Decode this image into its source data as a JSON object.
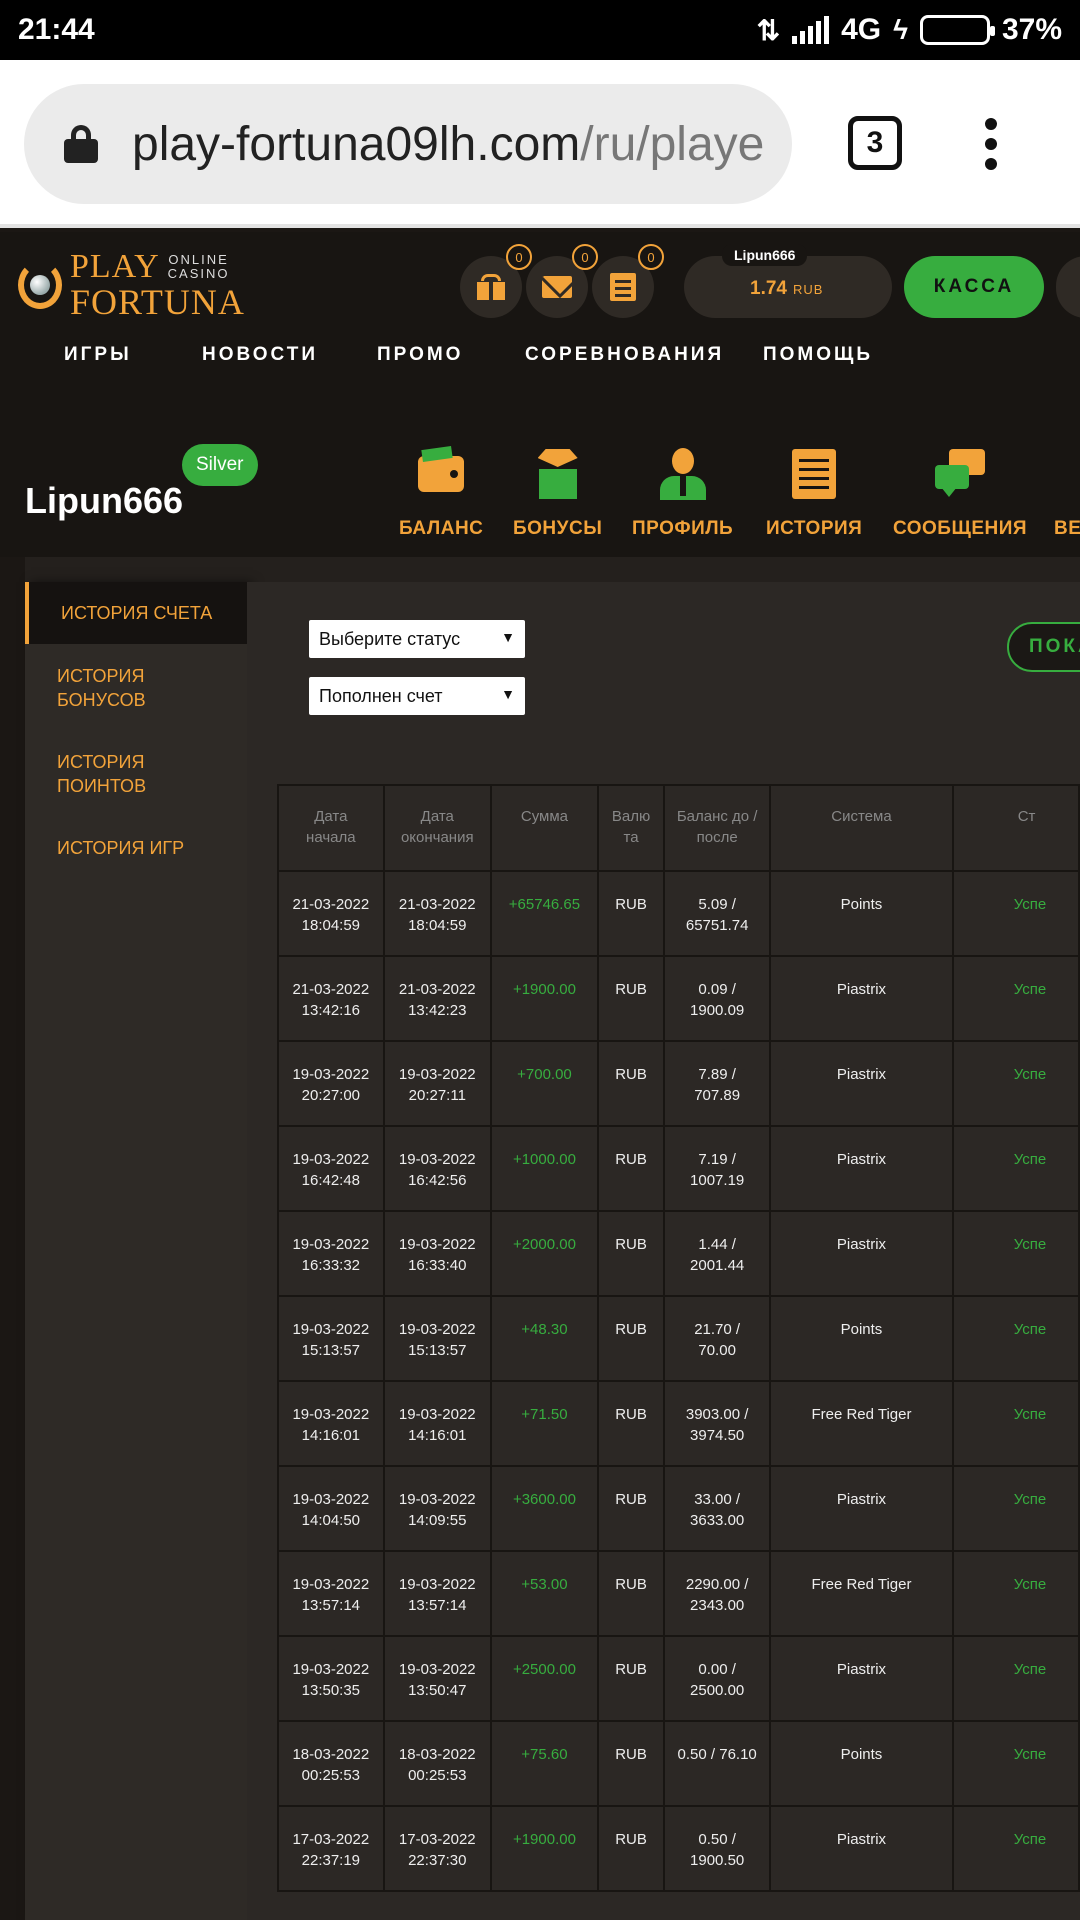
{
  "statusbar": {
    "time": "21:44",
    "network": "4G",
    "battery": "37%"
  },
  "browser": {
    "url_host": "play-fortuna09lh.com",
    "url_path": "/ru/playe",
    "tab_count": "3"
  },
  "header": {
    "logo": {
      "play": "PLAY",
      "online": "ONLINE",
      "casino": "CASINO",
      "fortuna": "FORTUNA"
    },
    "badges": {
      "gifts": "0",
      "messages": "0",
      "notes": "0"
    },
    "balance": {
      "username": "Lipun666",
      "amount": "1.74",
      "currency": "RUB"
    },
    "kassa_label": "КАССА",
    "nav": [
      "ИГРЫ",
      "НОВОСТИ",
      "ПРОМО",
      "СОРЕВНОВАНИЯ",
      "ПОМОЩЬ"
    ]
  },
  "profile": {
    "username": "Lipun666",
    "level": "Silver",
    "tabs": [
      "БАЛАНС",
      "БОНУСЫ",
      "ПРОФИЛЬ",
      "ИСТОРИЯ",
      "СООБЩЕНИЯ",
      "ВЕ"
    ]
  },
  "sidebar": {
    "items": [
      {
        "line1": "ИСТОРИЯ СЧЕТА",
        "line2": ""
      },
      {
        "line1": "ИСТОРИЯ",
        "line2": "БОНУСОВ"
      },
      {
        "line1": "ИСТОРИЯ",
        "line2": "ПОИНТОВ"
      },
      {
        "line1": "ИСТОРИЯ ИГР",
        "line2": ""
      }
    ]
  },
  "filters": {
    "status_select": "Выберите статус",
    "type_select": "Пополнен счет",
    "show_button": "ПОКА"
  },
  "table": {
    "headers": [
      {
        "l1": "Дата",
        "l2": "начала"
      },
      {
        "l1": "Дата",
        "l2": "окончания"
      },
      {
        "l1": "Сумма",
        "l2": ""
      },
      {
        "l1": "Валю",
        "l2": "та"
      },
      {
        "l1": "Баланс до /",
        "l2": "после"
      },
      {
        "l1": "Система",
        "l2": ""
      },
      {
        "l1": "Ст",
        "l2": ""
      }
    ],
    "rows": [
      {
        "sd": "21-03-2022",
        "st": "18:04:59",
        "ed": "21-03-2022",
        "et": "18:04:59",
        "sum": "+65746.65",
        "cur": "RUB",
        "b1": "5.09 /",
        "b2": "65751.74",
        "sys": "Points",
        "status": "Успе"
      },
      {
        "sd": "21-03-2022",
        "st": "13:42:16",
        "ed": "21-03-2022",
        "et": "13:42:23",
        "sum": "+1900.00",
        "cur": "RUB",
        "b1": "0.09 /",
        "b2": "1900.09",
        "sys": "Piastrix",
        "status": "Успе"
      },
      {
        "sd": "19-03-2022",
        "st": "20:27:00",
        "ed": "19-03-2022",
        "et": "20:27:11",
        "sum": "+700.00",
        "cur": "RUB",
        "b1": "7.89 /",
        "b2": "707.89",
        "sys": "Piastrix",
        "status": "Успе"
      },
      {
        "sd": "19-03-2022",
        "st": "16:42:48",
        "ed": "19-03-2022",
        "et": "16:42:56",
        "sum": "+1000.00",
        "cur": "RUB",
        "b1": "7.19 /",
        "b2": "1007.19",
        "sys": "Piastrix",
        "status": "Успе"
      },
      {
        "sd": "19-03-2022",
        "st": "16:33:32",
        "ed": "19-03-2022",
        "et": "16:33:40",
        "sum": "+2000.00",
        "cur": "RUB",
        "b1": "1.44 /",
        "b2": "2001.44",
        "sys": "Piastrix",
        "status": "Успе"
      },
      {
        "sd": "19-03-2022",
        "st": "15:13:57",
        "ed": "19-03-2022",
        "et": "15:13:57",
        "sum": "+48.30",
        "cur": "RUB",
        "b1": "21.70 /",
        "b2": "70.00",
        "sys": "Points",
        "status": "Успе"
      },
      {
        "sd": "19-03-2022",
        "st": "14:16:01",
        "ed": "19-03-2022",
        "et": "14:16:01",
        "sum": "+71.50",
        "cur": "RUB",
        "b1": "3903.00 /",
        "b2": "3974.50",
        "sys": "Free Red Tiger",
        "status": "Успе"
      },
      {
        "sd": "19-03-2022",
        "st": "14:04:50",
        "ed": "19-03-2022",
        "et": "14:09:55",
        "sum": "+3600.00",
        "cur": "RUB",
        "b1": "33.00 /",
        "b2": "3633.00",
        "sys": "Piastrix",
        "status": "Успе"
      },
      {
        "sd": "19-03-2022",
        "st": "13:57:14",
        "ed": "19-03-2022",
        "et": "13:57:14",
        "sum": "+53.00",
        "cur": "RUB",
        "b1": "2290.00 /",
        "b2": "2343.00",
        "sys": "Free Red Tiger",
        "status": "Успе"
      },
      {
        "sd": "19-03-2022",
        "st": "13:50:35",
        "ed": "19-03-2022",
        "et": "13:50:47",
        "sum": "+2500.00",
        "cur": "RUB",
        "b1": "0.00 /",
        "b2": "2500.00",
        "sys": "Piastrix",
        "status": "Успе"
      },
      {
        "sd": "18-03-2022",
        "st": "00:25:53",
        "ed": "18-03-2022",
        "et": "00:25:53",
        "sum": "+75.60",
        "cur": "RUB",
        "b1": "0.50 / 76.10",
        "b2": "",
        "sys": "Points",
        "status": "Успе"
      },
      {
        "sd": "17-03-2022",
        "st": "22:37:19",
        "ed": "17-03-2022",
        "et": "22:37:30",
        "sum": "+1900.00",
        "cur": "RUB",
        "b1": "0.50 /",
        "b2": "1900.50",
        "sys": "Piastrix",
        "status": "Успе"
      }
    ]
  },
  "colors": {
    "accent": "#f2a33a",
    "green": "#37ad3f",
    "bg": "#181512"
  }
}
